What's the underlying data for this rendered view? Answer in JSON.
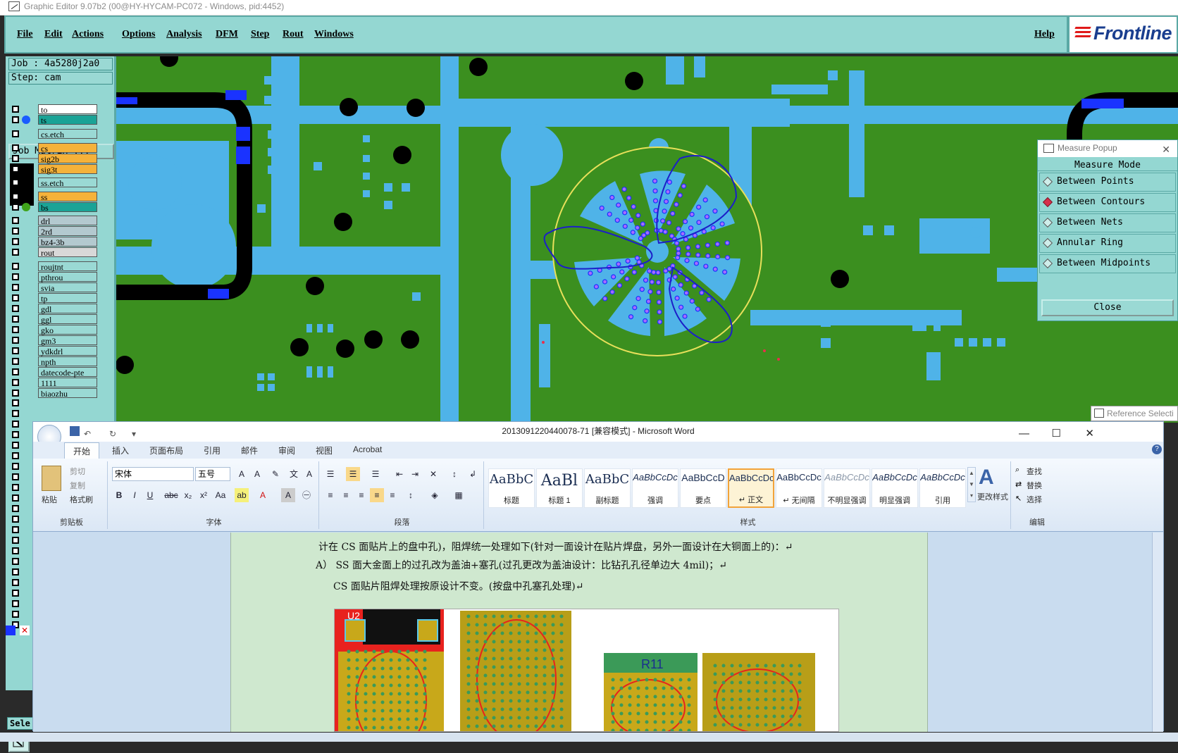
{
  "ge": {
    "title": "Graphic Editor 9.07b2 (00@HY-HYCAM-PC072 - Windows, pid:4452)",
    "menu": [
      "File",
      "Edit",
      "Actions",
      "Options",
      "Analysis",
      "DFM",
      "Step",
      "Rout",
      "Windows"
    ],
    "help": "Help",
    "logo": "Frontline",
    "job": "Job : 4a5280j2a0",
    "step": "Step: cam",
    "job_matrix": "Job Matrix ...",
    "sele": "Sele",
    "layers": [
      {
        "name": "to",
        "color": "#ffffff",
        "dot": ""
      },
      {
        "name": "ts",
        "color": "#1aa396",
        "dot": "#1a5cff"
      },
      {
        "name": "cs.etch",
        "color": "#9ad9d4",
        "dot": ""
      },
      {
        "name": "cs",
        "color": "#f5b23a",
        "dot": ""
      },
      {
        "name": "sig2b",
        "color": "#f5b23a",
        "dot": ""
      },
      {
        "name": "sig3t",
        "color": "#f5b23a",
        "dot": ""
      },
      {
        "name": "ss.etch",
        "color": "#9ad9d4",
        "dot": ""
      },
      {
        "name": "ss",
        "color": "#f5b23a",
        "dot": ""
      },
      {
        "name": "bs",
        "color": "#1aa396",
        "dot": "#3fa31a"
      },
      {
        "name": "drl",
        "color": "#b3c9cf",
        "dot": ""
      },
      {
        "name": "2rd",
        "color": "#b3c9cf",
        "dot": ""
      },
      {
        "name": "bz4-3b",
        "color": "#b3c9cf",
        "dot": ""
      },
      {
        "name": "rout",
        "color": "#d8d8d8",
        "dot": ""
      },
      {
        "name": "roujtnt",
        "color": "#9ad9d4",
        "dot": ""
      },
      {
        "name": "pthrou",
        "color": "#9ad9d4",
        "dot": ""
      },
      {
        "name": "svia",
        "color": "#9ad9d4",
        "dot": ""
      },
      {
        "name": "tp",
        "color": "#9ad9d4",
        "dot": ""
      },
      {
        "name": "gdl",
        "color": "#9ad9d4",
        "dot": ""
      },
      {
        "name": "ggl",
        "color": "#9ad9d4",
        "dot": ""
      },
      {
        "name": "gko",
        "color": "#9ad9d4",
        "dot": ""
      },
      {
        "name": "gm3",
        "color": "#9ad9d4",
        "dot": ""
      },
      {
        "name": "ydkdrl",
        "color": "#9ad9d4",
        "dot": ""
      },
      {
        "name": "npth",
        "color": "#9ad9d4",
        "dot": ""
      },
      {
        "name": "datecode-pte",
        "color": "#9ad9d4",
        "dot": ""
      },
      {
        "name": "1111",
        "color": "#9ad9d4",
        "dot": ""
      },
      {
        "name": "biaozhu",
        "color": "#9ad9d4",
        "dot": ""
      }
    ],
    "colors": {
      "board": "#3b8f1f",
      "copper": "#4fb3e8",
      "pad_blue": "#1a33ff",
      "black": "#000000",
      "circle": "#e8e05a",
      "sketch": "#1c1fc8"
    }
  },
  "measure": {
    "title": "Measure Popup",
    "mode_label": "Measure Mode",
    "options": [
      "Between Points",
      "Between Contours",
      "Between Nets",
      "Annular Ring",
      "Between Midpoints"
    ],
    "selected": "Between Contours",
    "close": "Close"
  },
  "refsel": "Reference Selecti",
  "word": {
    "title": "2013091220440078-71 [兼容模式] - Microsoft Word",
    "tabs": [
      "开始",
      "插入",
      "页面布局",
      "引用",
      "邮件",
      "审阅",
      "视图",
      "Acrobat"
    ],
    "clipboard": {
      "paste": "粘贴",
      "cut": "剪切",
      "copy": "复制",
      "format_painter": "格式刷",
      "label": "剪贴板"
    },
    "font": {
      "name": "宋体",
      "size": "五号",
      "label": "字体"
    },
    "paragraph_label": "段落",
    "styles_label": "样式",
    "styles": [
      {
        "preview": "AaBbC",
        "name": "标题"
      },
      {
        "preview": "AaBl",
        "name": "标题 1"
      },
      {
        "preview": "AaBbC",
        "name": "副标题"
      },
      {
        "preview": "AaBbCcDc",
        "name": "强调"
      },
      {
        "preview": "AaBbCcD",
        "name": "要点"
      },
      {
        "preview": "AaBbCcDc",
        "name": "↵ 正文"
      },
      {
        "preview": "AaBbCcDc",
        "name": "↵ 无间隔"
      },
      {
        "preview": "AaBbCcDc",
        "name": "不明显强调"
      },
      {
        "preview": "AaBbCcDc",
        "name": "明显强调"
      },
      {
        "preview": "AaBbCcDc",
        "name": "引用"
      }
    ],
    "change_styles": "更改样式",
    "edit": {
      "find": "查找",
      "replace": "替换",
      "select": "选择",
      "label": "编辑"
    },
    "doc_lines": [
      "计在 CS 面贴片上的盘中孔)，阻焊统一处理如下(针对一面设计在贴片焊盘，另外一面设计在大铜面上的)：↵",
      "A）  SS 面大金面上的过孔改为盖油+塞孔(过孔更改为盖油设计：比钻孔孔径单边大 4mil)；↵",
      "CS 面贴片阻焊处理按原设计不变。(按盘中孔塞孔处理)↵"
    ],
    "fig_labels": {
      "u2": "U2",
      "r11": "R11"
    }
  }
}
